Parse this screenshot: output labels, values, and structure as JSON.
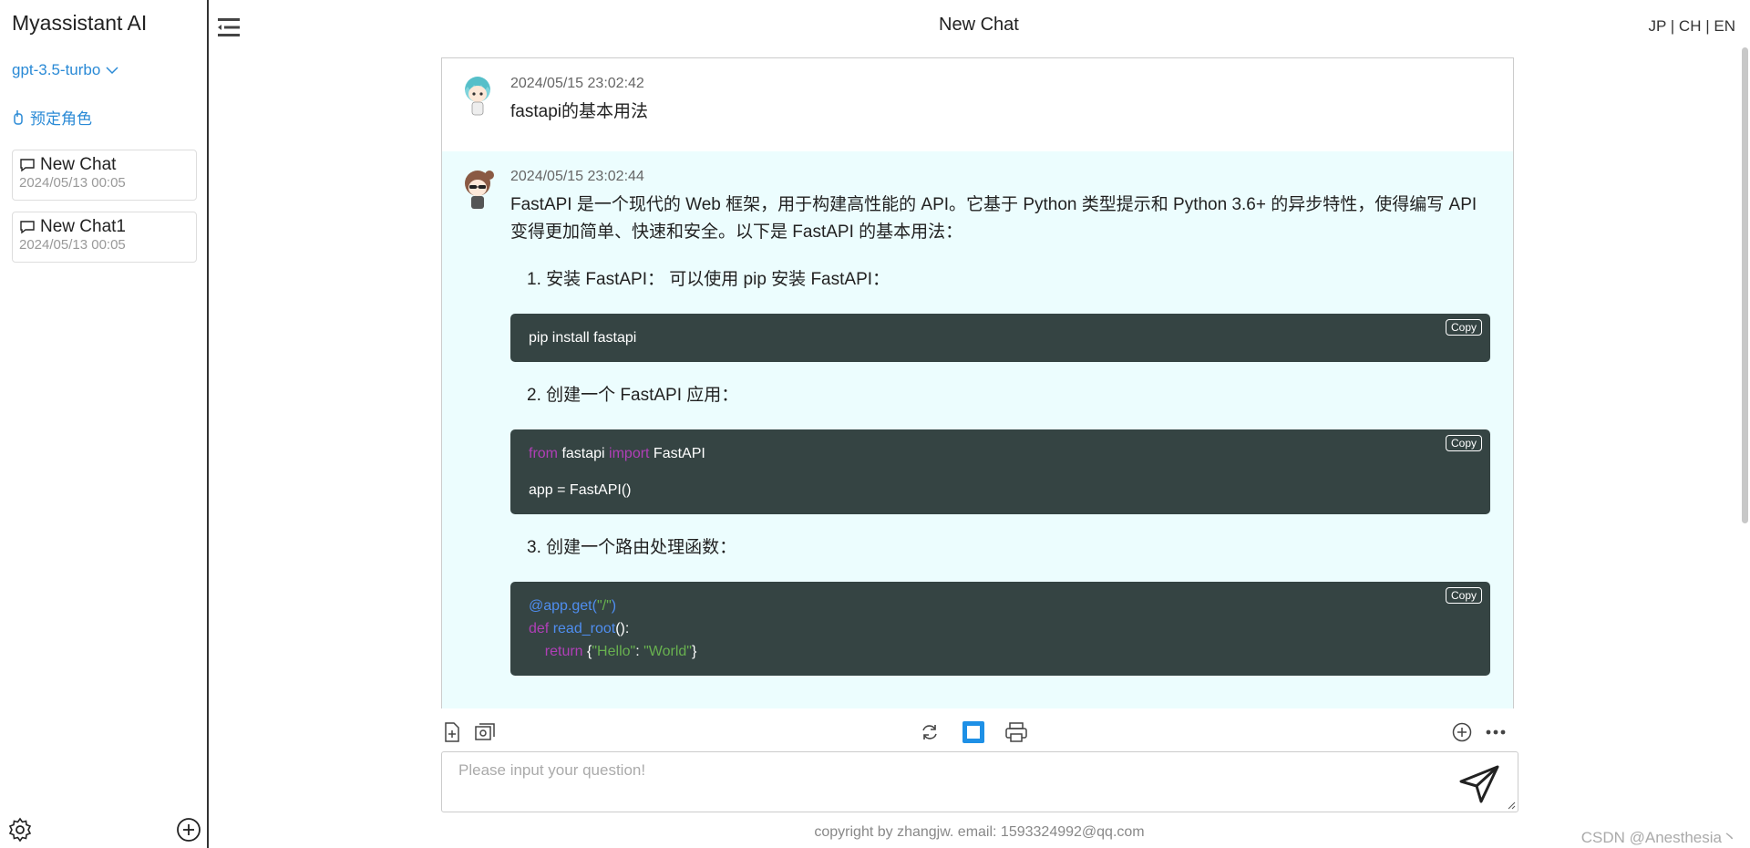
{
  "app": {
    "title": "Myassistant AI"
  },
  "sidebar": {
    "model": "gpt-3.5-turbo",
    "role_button": "预定角色",
    "chats": [
      {
        "title": "New Chat",
        "date": "2024/05/13 00:05"
      },
      {
        "title": "New Chat1",
        "date": "2024/05/13 00:05"
      }
    ]
  },
  "header": {
    "title": "New Chat",
    "lang_jp": "JP",
    "lang_ch": "CH",
    "lang_en": "EN",
    "separator": "|"
  },
  "messages": {
    "user": {
      "time": "2024/05/15 23:02:42",
      "text": "fastapi的基本用法"
    },
    "bot": {
      "time": "2024/05/15 23:02:44",
      "intro": "FastAPI 是一个现代的 Web 框架，用于构建高性能的 API。它基于 Python 类型提示和 Python 3.6+ 的异步特性，使得编写 API 变得更加简单、快速和安全。以下是 FastAPI 的基本用法：",
      "steps": [
        "1. 安装 FastAPI： 可以使用 pip 安装 FastAPI：",
        "2. 创建一个 FastAPI 应用：",
        "3. 创建一个路由处理函数："
      ],
      "copy_label": "Copy",
      "code1": {
        "line1": "pip install fastapi"
      },
      "code2": {
        "kw_from": "from",
        "mod": " fastapi ",
        "kw_import": "import",
        "cls": " FastAPI",
        "line3": "app = FastAPI()"
      },
      "code3": {
        "decorator": "@app.get(",
        "path": "\"/\"",
        "close_paren": ")",
        "kw_def": "def",
        "fn_name": " read_root",
        "fn_tail": "():",
        "indent": "    ",
        "kw_return": "return",
        "brace_open": " {",
        "key": "\"Hello\"",
        "colon": ": ",
        "val": "\"World\"",
        "brace_close": "}"
      }
    }
  },
  "input": {
    "placeholder": "Please input your question!"
  },
  "footer": {
    "text": "copyright by zhangjw. email: 1593324992@qq.com"
  },
  "watermark": "CSDN @Anesthesia丶",
  "colors": {
    "accent": "#2a8ad6",
    "bot_bg": "#ecfdfe",
    "code_bg": "#354443",
    "toggle_active": "#1e90e6"
  }
}
